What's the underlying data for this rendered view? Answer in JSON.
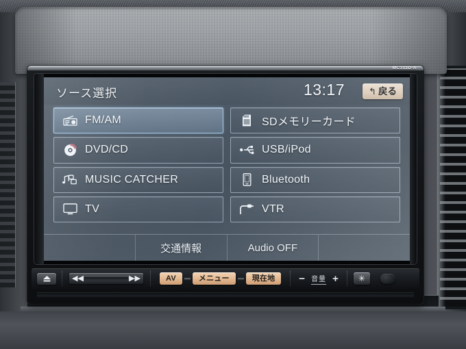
{
  "device": {
    "model_label": "MC311D-A"
  },
  "screen": {
    "title": "ソース選択",
    "clock": "13:17",
    "back_button": {
      "icon": "return-arrow-icon",
      "glyph": "↰",
      "label": "戻る"
    },
    "sources": [
      {
        "id": "fm-am",
        "label": "FM/AM",
        "icon": "radio-icon",
        "selected": true
      },
      {
        "id": "sd-memory",
        "label": "SDメモリーカード",
        "icon": "sd-card-icon",
        "selected": false
      },
      {
        "id": "dvd-cd",
        "label": "DVD/CD",
        "icon": "disc-icon",
        "selected": false
      },
      {
        "id": "usb-ipod",
        "label": "USB/iPod",
        "icon": "usb-icon",
        "selected": false
      },
      {
        "id": "music-catcher",
        "label": "MUSIC CATCHER",
        "icon": "music-note-icon",
        "selected": false
      },
      {
        "id": "bluetooth",
        "label": "Bluetooth",
        "icon": "phone-icon",
        "selected": false
      },
      {
        "id": "tv",
        "label": "TV",
        "icon": "monitor-icon",
        "selected": false
      },
      {
        "id": "vtr",
        "label": "VTR",
        "icon": "plug-icon",
        "selected": false
      }
    ],
    "bottom_tabs": [
      {
        "id": "blank-left",
        "label": ""
      },
      {
        "id": "traffic-info",
        "label": "交通情報"
      },
      {
        "id": "audio-off",
        "label": "Audio OFF"
      },
      {
        "id": "blank-right",
        "label": ""
      }
    ]
  },
  "hardware_bar": {
    "eject": {
      "label": "",
      "icon": "eject-icon"
    },
    "seek_prev": {
      "glyph": "◀◀",
      "icon": "previous-track-icon"
    },
    "seek_next": {
      "glyph": "▶▶",
      "icon": "next-track-icon"
    },
    "av_button": "AV",
    "menu_button": "メニュー",
    "current_location_button": "現在地",
    "volume_down": "−",
    "volume_label": "音量",
    "volume_up": "+",
    "display_button": {
      "glyph": "✳",
      "icon": "brightness-icon"
    }
  },
  "colors": {
    "lcd_background": "#4b5763",
    "selected_button": "#96acc2",
    "button_border": "#c4d2e0",
    "amber_button": "#e3b992",
    "back_button": "#ddcdbb",
    "text": "#f2f6fa"
  }
}
